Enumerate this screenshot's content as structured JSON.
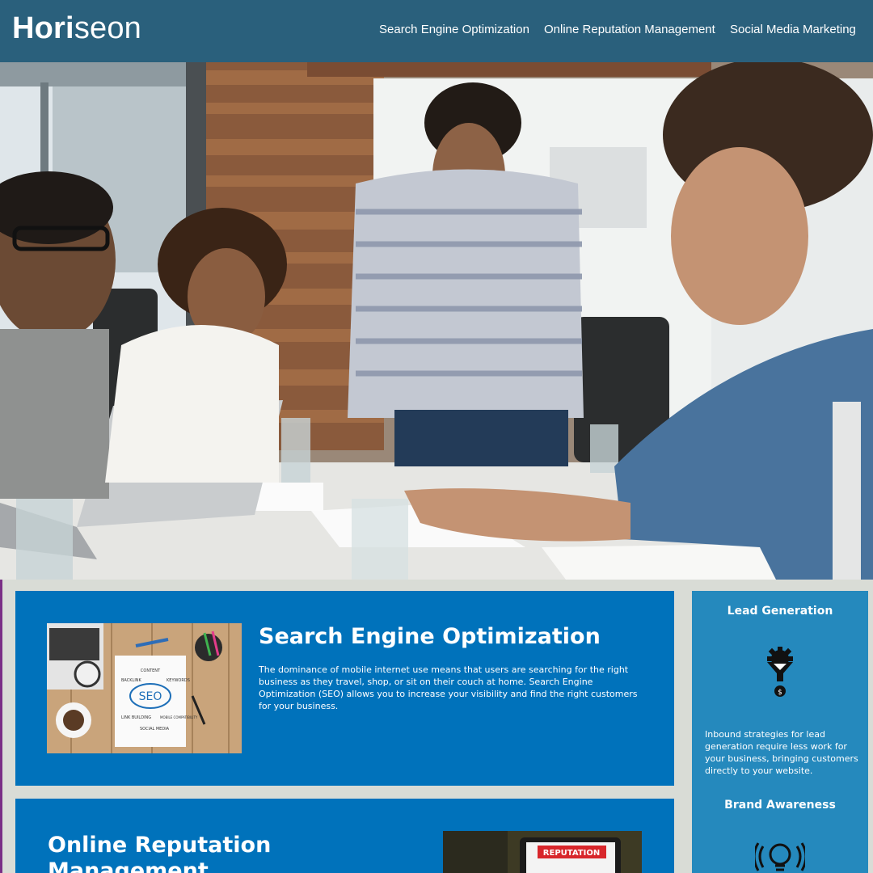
{
  "header": {
    "logo_bold": "Hori",
    "logo_light": "seon",
    "nav": [
      {
        "label": "Search Engine Optimization"
      },
      {
        "label": "Online Reputation Management"
      },
      {
        "label": "Social Media Marketing"
      }
    ]
  },
  "hero": {
    "image": "team-meeting-photo"
  },
  "content": [
    {
      "title": "Search Engine Optimization",
      "text": "The dominance of mobile internet use means that users are searching for the right business as they travel, shop, or sit on their couch at home. Search Engine Optimization (SEO) allows you to increase your visibility and find the right customers for your business.",
      "image_words": [
        "CONTENT",
        "BACKLINK",
        "SEO",
        "LINK BUILDING",
        "SOCIAL MEDIA",
        "MOBILE COMPATIBILITY",
        "KEYWORDS"
      ]
    },
    {
      "title": "Online Reputation Management",
      "image_words": [
        "REPUTATION"
      ]
    }
  ],
  "sidebar": [
    {
      "title": "Lead Generation",
      "icon": "lead-generation-funnel-icon",
      "text": "Inbound strategies for lead generation require less work for your business, bringing customers directly to your website."
    },
    {
      "title": "Brand Awareness",
      "icon": "brand-awareness-lightbulb-icon"
    }
  ],
  "colors": {
    "header": "#2a607c",
    "content_box": "#0072bb",
    "sidebar": "#2589bd",
    "page_bg": "#d9dcd6"
  }
}
